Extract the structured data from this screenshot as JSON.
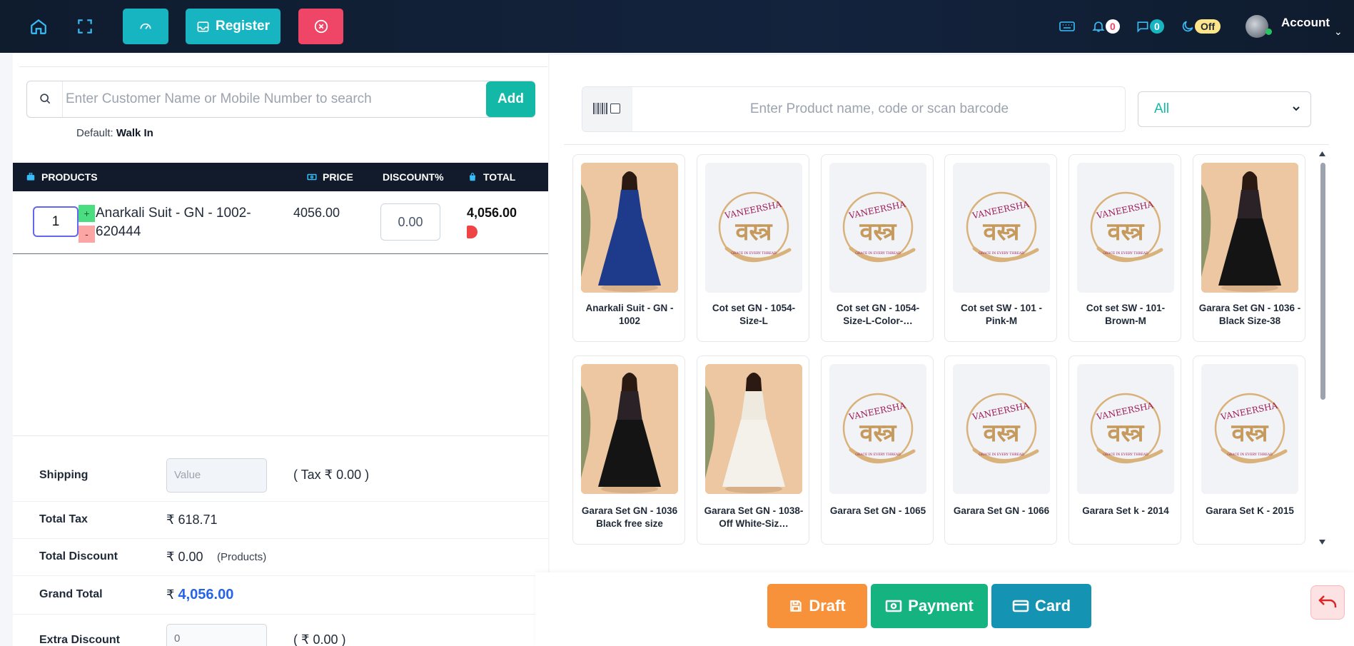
{
  "nav": {
    "register_label": "Register",
    "notifications_count": "0",
    "messages_count": "0",
    "toggle_state": "Off",
    "account_label": "Account"
  },
  "customer": {
    "search_placeholder": "Enter Customer Name or Mobile Number to search",
    "add_label": "Add",
    "default_label": "Default:",
    "default_value": "Walk In"
  },
  "table": {
    "headers": {
      "products": "PRODUCTS",
      "price": "PRICE",
      "discount": "DISCOUNT%",
      "total": "TOTAL"
    },
    "rows": [
      {
        "qty": "1",
        "plus": "+",
        "minus": "-",
        "name": "Anarkali Suit - GN - 1002-620444",
        "price": "4056.00",
        "discount": "0.00",
        "total": "4,056.00"
      }
    ]
  },
  "summary": {
    "shipping_label": "Shipping",
    "shipping_placeholder": "Value",
    "shipping_tax": "( Tax ₹ 0.00 )",
    "total_tax_label": "Total Tax",
    "total_tax_value": "₹ 618.71",
    "total_discount_label": "Total Discount",
    "total_discount_value": "₹ 0.00",
    "total_discount_note": "(Products)",
    "grand_total_label": "Grand Total",
    "grand_total_currency": "₹",
    "grand_total_value": "4,056.00",
    "extra_discount_label": "Extra Discount",
    "extra_discount_value": "0",
    "extra_discount_note": "( ₹ 0.00 )"
  },
  "products": {
    "search_placeholder": "Enter Product name, code or scan barcode",
    "category_selected": "All",
    "items": [
      {
        "name": "Anarkali Suit - GN - 1002",
        "image": "photo-navy-anarkali"
      },
      {
        "name": "Cot set GN - 1054-Size-L",
        "image": "brand-logo"
      },
      {
        "name": "Cot set GN - 1054-Size-L-Color-…",
        "image": "brand-logo"
      },
      {
        "name": "Cot set SW - 101 - Pink-M",
        "image": "brand-logo"
      },
      {
        "name": "Cot set SW - 101-Brown-M",
        "image": "brand-logo"
      },
      {
        "name": "Garara Set GN - 1036 - Black  Size-38",
        "image": "photo-black-garara"
      },
      {
        "name": "Garara Set GN - 1036 Black free size",
        "image": "photo-black-garara"
      },
      {
        "name": "Garara Set GN - 1038-Off White-Siz…",
        "image": "photo-white-garara"
      },
      {
        "name": "Garara Set GN - 1065",
        "image": "brand-logo"
      },
      {
        "name": "Garara Set GN - 1066",
        "image": "brand-logo"
      },
      {
        "name": "Garara Set k - 2014",
        "image": "brand-logo"
      },
      {
        "name": "Garara Set K - 2015",
        "image": "brand-logo"
      }
    ],
    "logo_text": "VANEERSHA",
    "logo_script": "वस्त्र",
    "logo_tagline": "GRACE IN EVERY THREAD"
  },
  "footer": {
    "draft_label": "Draft",
    "payment_label": "Payment",
    "card_label": "Card"
  },
  "colors": {
    "teal": "#17b5c1",
    "red": "#ef4566",
    "draft": "#f7923a",
    "payment": "#14b37f",
    "card": "#1593b3",
    "grand_total": "#2563eb"
  }
}
